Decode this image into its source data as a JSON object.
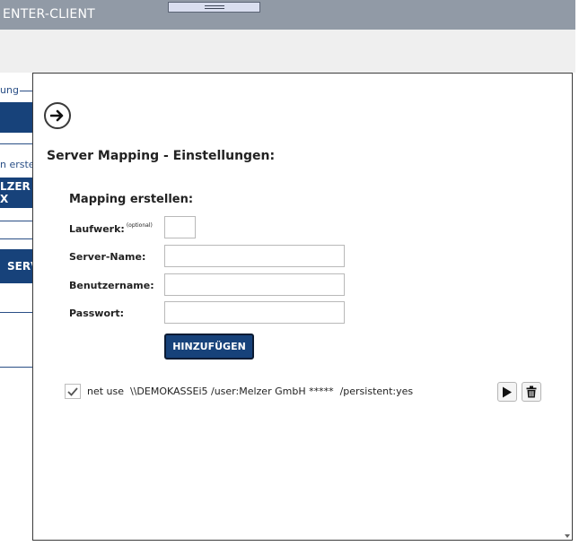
{
  "app": {
    "title": "ENTER-CLIENT"
  },
  "background": {
    "section_label_1": "ung",
    "link_text": "n erstel",
    "button_1": "LZER X",
    "button_2": "SERV"
  },
  "dialog": {
    "heading": "Server Mapping - Einstellungen:",
    "subheading": "Mapping erstellen:",
    "fields": {
      "laufwerk_label": "Laufwerk:",
      "laufwerk_hint": "(optional)",
      "laufwerk_value": "",
      "server_label": "Server-Name:",
      "server_value": "",
      "user_label": "Benutzername:",
      "user_value": "",
      "password_label": "Passwort:",
      "password_value": ""
    },
    "add_button": "HINZUFÜGEN",
    "mapping_entry": {
      "checked": true,
      "command": "net use  \\\\DEMOKASSEi5 /user:Melzer GmbH *****  /persistent:yes"
    }
  },
  "icons": {
    "back": "arrow-right-icon",
    "run": "play-icon",
    "delete": "trash-icon",
    "check": "checkmark-icon"
  },
  "colors": {
    "topbar": "#919aa6",
    "accent": "#17427a",
    "accent_text": "#2a4f86"
  }
}
